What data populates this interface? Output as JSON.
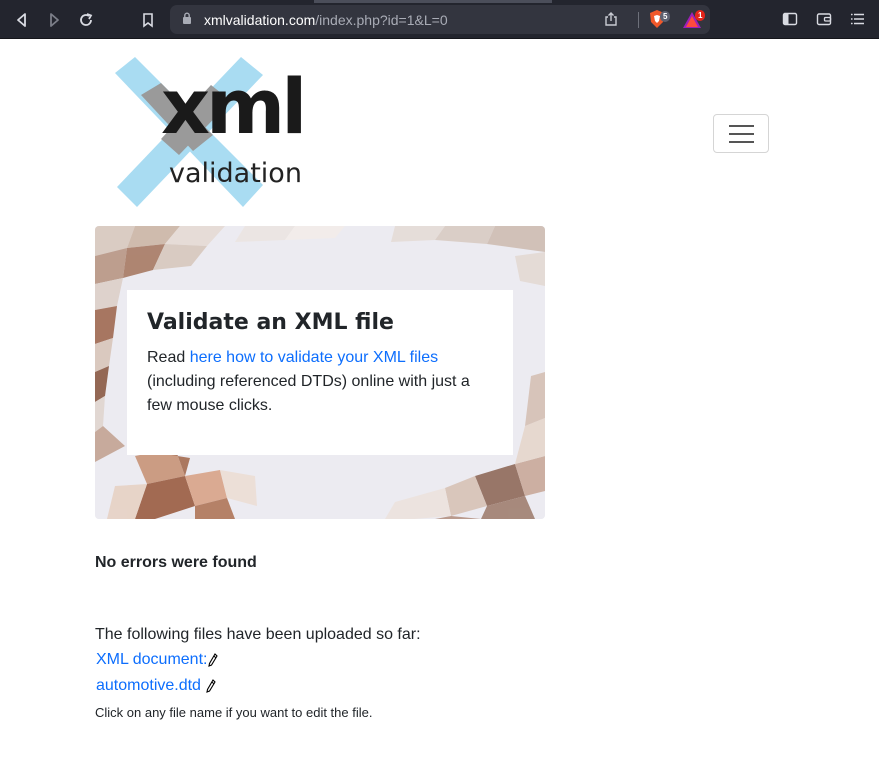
{
  "browser": {
    "url_domain": "xmlvalidation.com",
    "url_path": "/index.php?id=1&L=0",
    "shield_count": "5",
    "rewards_count": "1"
  },
  "logo": {
    "main": "xml",
    "sub": "validation"
  },
  "hero": {
    "title": "Validate an XML file",
    "text_before": "Read ",
    "link": "here how to validate your XML files",
    "text_after": " (including referenced DTDs) online with just a few mouse clicks."
  },
  "result": {
    "status": "No errors were found"
  },
  "files": {
    "intro": "The following files have been uploaded so far:",
    "items": [
      {
        "name": "XML document:"
      },
      {
        "name": "automotive.dtd"
      }
    ],
    "hint": "Click on any file name if you want to edit the file."
  },
  "colors": {
    "link": "#0d6efd",
    "logo_x": "#a9dcf2",
    "chrome": "#23252e"
  }
}
